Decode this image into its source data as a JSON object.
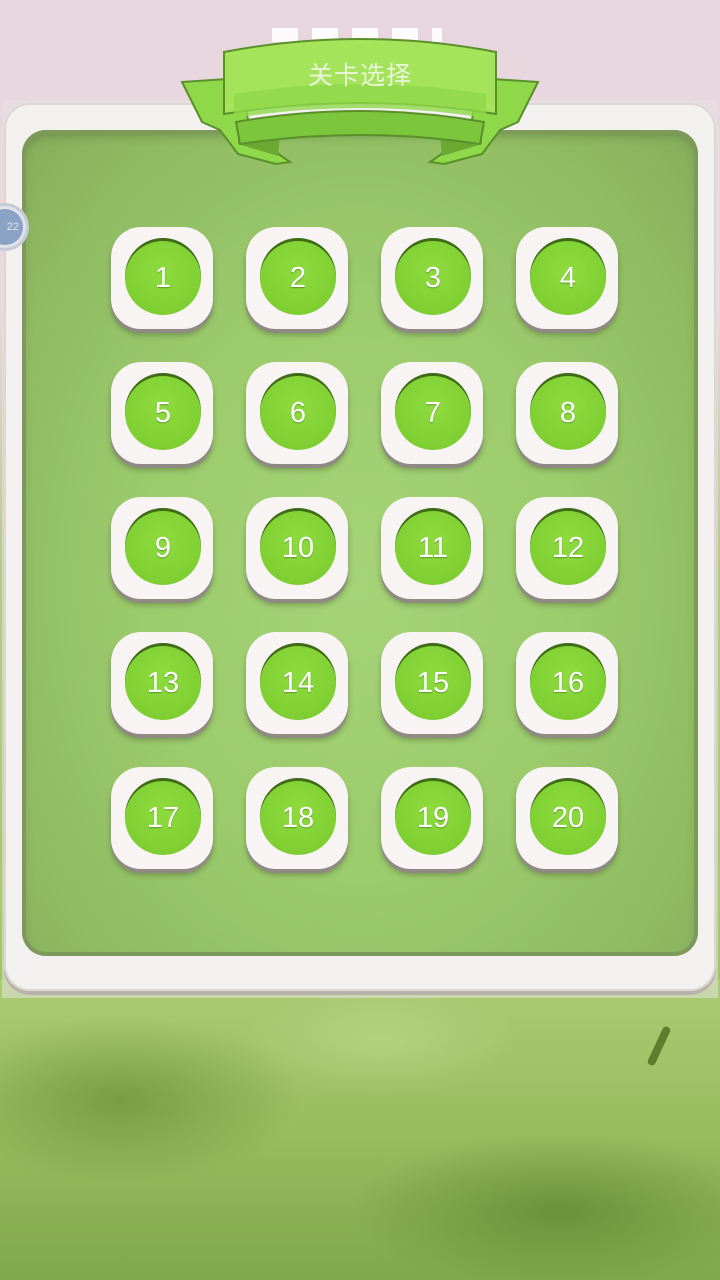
{
  "title": "关卡选择",
  "side_button_label": "22",
  "levels": [
    "1",
    "2",
    "3",
    "4",
    "5",
    "6",
    "7",
    "8",
    "9",
    "10",
    "11",
    "12",
    "13",
    "14",
    "15",
    "16",
    "17",
    "18",
    "19",
    "20"
  ],
  "colors": {
    "panel_green": "#9ccb6c",
    "level_green": "#7fcf33",
    "ribbon_green": "#a5e35a",
    "tile_white": "#f7f4f3"
  }
}
